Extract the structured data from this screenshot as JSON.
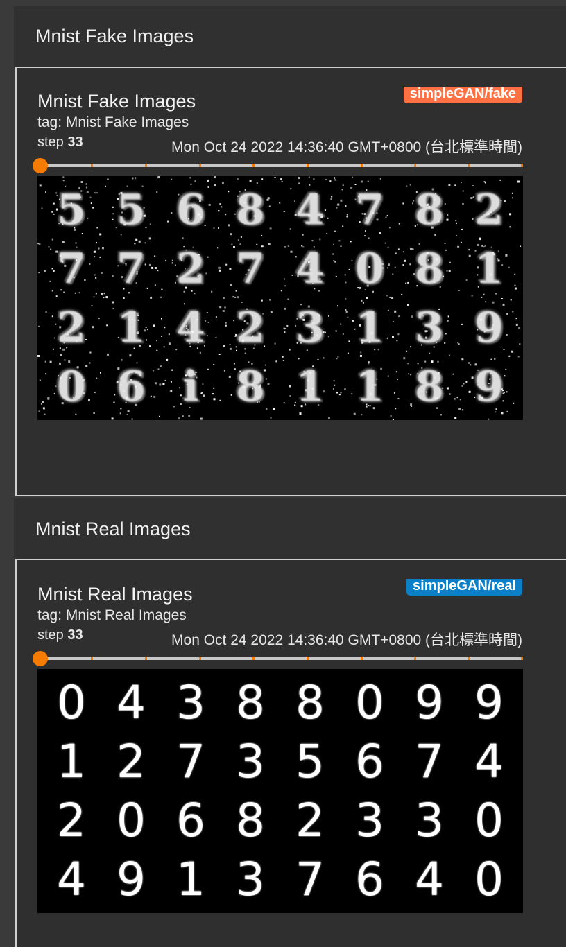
{
  "sections": [
    {
      "header_title": "Mnist Fake Images",
      "card": {
        "title": "Mnist Fake Images",
        "tag": "tag: Mnist Fake Images",
        "step_label": "step",
        "step_value": "33",
        "timestamp": "Mon Oct 24 2022 14:36:40 GMT+0800 (台北標準時間)",
        "run_badge": "simpleGAN/fake",
        "run_color": "#ff7043",
        "slider_position": 0,
        "digits": [
          [
            "5",
            "5",
            "6",
            "8",
            "4",
            "7",
            "8",
            "2"
          ],
          [
            "7",
            "7",
            "2",
            "7",
            "4",
            "0",
            "8",
            "1"
          ],
          [
            "2",
            "1",
            "4",
            "2",
            "3",
            "1",
            "3",
            "9"
          ],
          [
            "0",
            "6",
            "i",
            "8",
            "1",
            "1",
            "8",
            "9"
          ]
        ]
      }
    },
    {
      "header_title": "Mnist Real Images",
      "card": {
        "title": "Mnist Real Images",
        "tag": "tag: Mnist Real Images",
        "step_label": "step",
        "step_value": "33",
        "timestamp": "Mon Oct 24 2022 14:36:40 GMT+0800 (台北標準時間)",
        "run_badge": "simpleGAN/real",
        "run_color": "#0b80c8",
        "slider_position": 0,
        "digits": [
          [
            "0",
            "4",
            "3",
            "8",
            "8",
            "0",
            "9",
            "9"
          ],
          [
            "1",
            "2",
            "7",
            "3",
            "5",
            "6",
            "7",
            "4"
          ],
          [
            "2",
            "0",
            "6",
            "8",
            "2",
            "3",
            "3",
            "0"
          ],
          [
            "4",
            "9",
            "1",
            "3",
            "7",
            "6",
            "4",
            "0"
          ]
        ]
      }
    }
  ]
}
